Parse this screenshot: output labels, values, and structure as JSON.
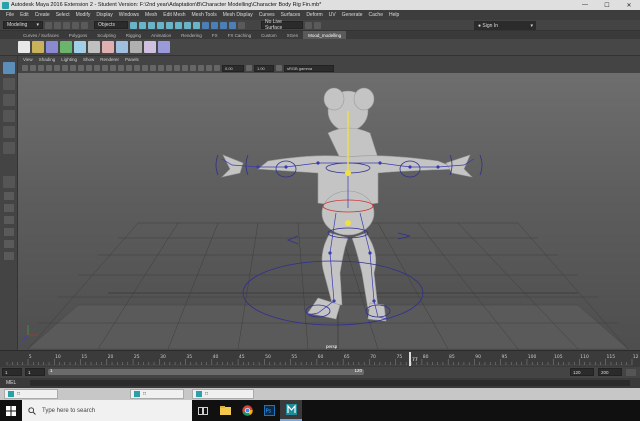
{
  "window": {
    "title": "Autodesk Maya 2016 Extension 2 - Student Version: F:\\2nd year\\Adaptation\\B\\Character Modelling\\Character Body Rig Fin.mb*",
    "minimize": "—",
    "maximize": "☐",
    "close": "✕"
  },
  "menus": [
    "File",
    "Edit",
    "Create",
    "Select",
    "Modify",
    "Display",
    "Windows",
    "Mesh",
    "Edit Mesh",
    "Mesh Tools",
    "Mesh Display",
    "Curves",
    "Surfaces",
    "Deform",
    "UV",
    "Generate",
    "Cache",
    "Help"
  ],
  "statusline": {
    "mode": "Modeling",
    "objects_label": "Objects",
    "live_surface": "No Live Surface",
    "sign_in": "Sign In"
  },
  "shelf_tabs": [
    "Curves / Surfaces",
    "Polygons",
    "Sculpting",
    "Rigging",
    "Animation",
    "Rendering",
    "FX",
    "FX Caching",
    "Custom",
    "XGen",
    "Mood_modelling"
  ],
  "shelf_active_index": 10,
  "viewport": {
    "menus": [
      "View",
      "Shading",
      "Lighting",
      "Show",
      "Renderer",
      "Panels"
    ],
    "field_a": "0.00",
    "field_b": "1.00",
    "color_space": "sRGB gamma",
    "camera": "persp"
  },
  "timeline": {
    "ticks": [
      "5",
      "10",
      "15",
      "20",
      "25",
      "30",
      "35",
      "40",
      "45",
      "50",
      "55",
      "60",
      "65",
      "70",
      "75",
      "80",
      "85",
      "90",
      "95",
      "100",
      "105",
      "110",
      "115",
      "12"
    ],
    "current_frame": "77",
    "range_start": "1",
    "range_start_inner": "1",
    "range_label_1": "1",
    "range_end_inner": "120",
    "range_end": "120",
    "anim_end": "200"
  },
  "mel": {
    "label": "MEL"
  },
  "taskbar": {
    "search_placeholder": "Type here to search",
    "mini_windows": [
      "□",
      "□",
      "□"
    ]
  },
  "colors": {
    "viewport_bg": "#6e6e6e",
    "selected_joint": "#f0e040",
    "rig_control": "#2f2f90",
    "highlight_control": "#d03030"
  }
}
